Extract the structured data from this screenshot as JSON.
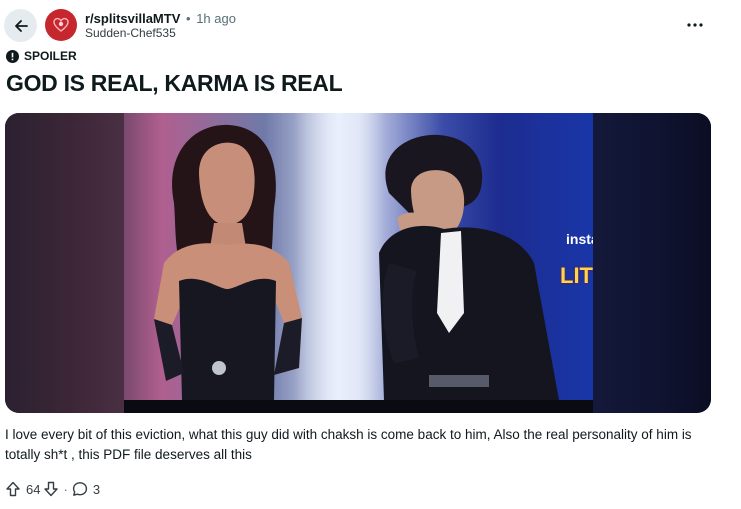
{
  "header": {
    "back_icon": "arrow-left-icon",
    "subreddit": "r/splitsvillaMTV",
    "separator": "•",
    "time_ago": "1h ago",
    "author": "Sudden-Chef535",
    "more_icon": "more-horizontal-icon"
  },
  "post": {
    "spoiler_label": "SPOILER",
    "title": "GOD IS REAL, KARMA IS REAL",
    "media": {
      "logo_text_1": "insta",
      "logo_text_2": "LITS"
    },
    "body": "I love every bit of this eviction, what this guy did with chaksh is come back to him, Also the real personality of him is totally sh*t , this PDF file deserves all this"
  },
  "actions": {
    "upvote_icon": "upvote-arrow-icon",
    "score": "64",
    "downvote_icon": "downvote-arrow-icon",
    "separator": "·",
    "comment_icon": "comment-bubble-icon",
    "comments": "3"
  },
  "colors": {
    "subreddit_avatar": "#c6262e",
    "back_button_bg": "#e5ebee",
    "text_primary": "#0f1a1c",
    "text_secondary": "#576f76"
  }
}
